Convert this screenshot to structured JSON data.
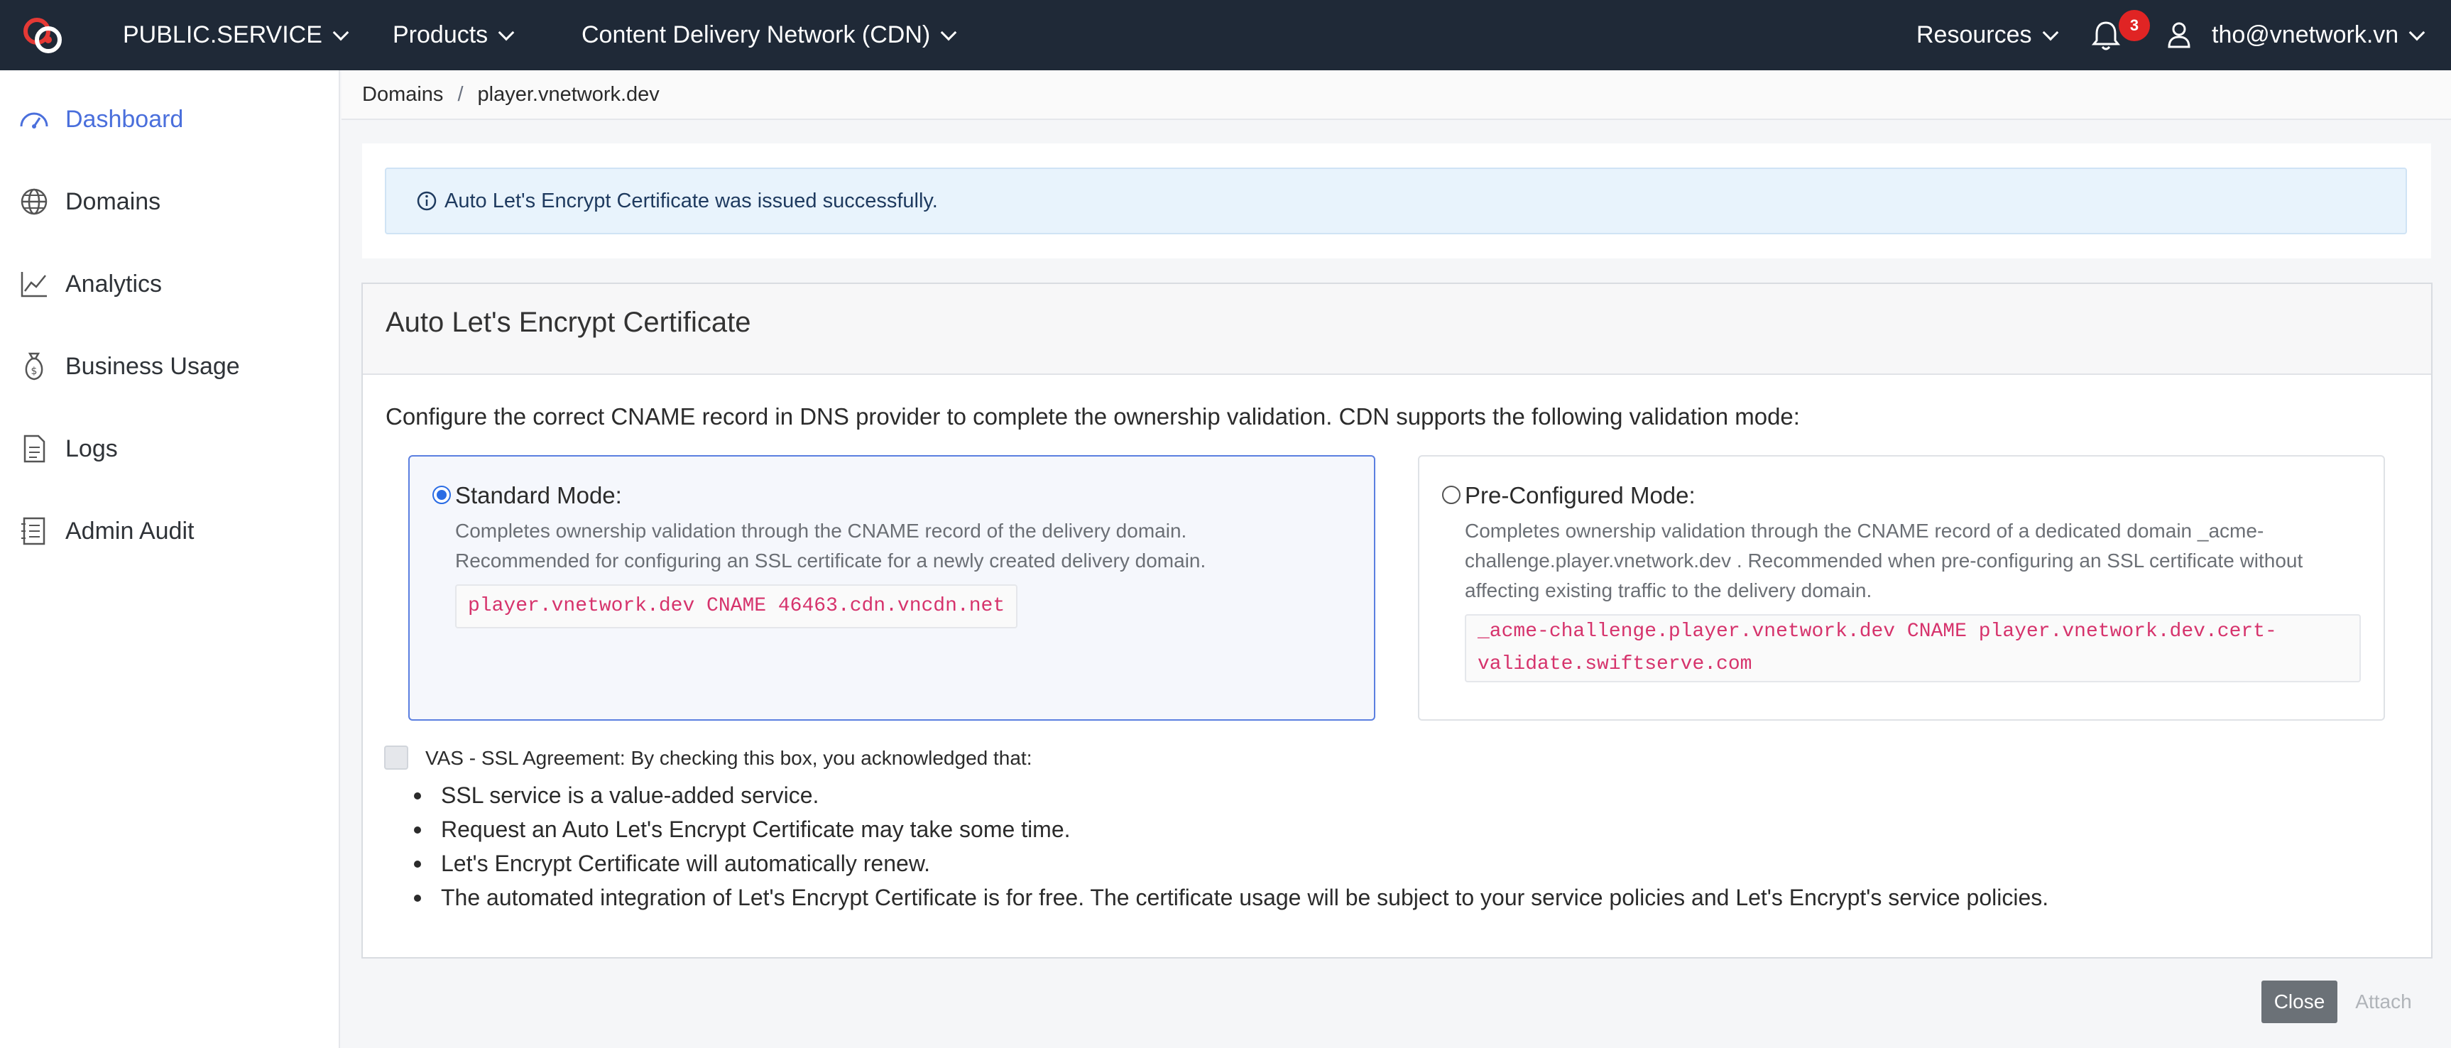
{
  "topbar": {
    "account": "PUBLIC.SERVICE",
    "products": "Products",
    "cdn": "Content Delivery Network (CDN)",
    "resources": "Resources",
    "notification_count": "3",
    "user_email": "tho@vnetwork.vn"
  },
  "sidebar": {
    "items": [
      {
        "label": "Dashboard",
        "icon": "dashboard-icon",
        "active": true
      },
      {
        "label": "Domains",
        "icon": "globe-icon"
      },
      {
        "label": "Analytics",
        "icon": "chart-line-icon"
      },
      {
        "label": "Business Usage",
        "icon": "money-bag-icon"
      },
      {
        "label": "Logs",
        "icon": "file-icon"
      },
      {
        "label": "Admin Audit",
        "icon": "audit-list-icon"
      }
    ]
  },
  "breadcrumb": {
    "root": "Domains",
    "separator": "/",
    "current": "player.vnetwork.dev"
  },
  "alert": {
    "message": "Auto Let's Encrypt Certificate was issued successfully."
  },
  "panel": {
    "title": "Auto Let's Encrypt Certificate",
    "description": "Configure the correct CNAME record in DNS provider to complete the ownership validation. CDN supports the following validation mode:",
    "standard": {
      "title": "Standard Mode:",
      "line1": "Completes ownership validation through the CNAME record of the delivery domain.",
      "line2": "Recommended for configuring an SSL certificate for a newly created delivery domain.",
      "record": "player.vnetwork.dev CNAME 46463.cdn.vncdn.net",
      "selected": true
    },
    "preconfigured": {
      "title": "Pre-Configured Mode:",
      "line1": "Completes ownership validation through the CNAME record of a dedicated domain _acme-",
      "line2": "challenge.player.vnetwork.dev . Recommended when pre-configuring an SSL certificate without",
      "line3": "affecting existing traffic to the delivery domain.",
      "record_line1": "_acme-challenge.player.vnetwork.dev CNAME player.vnetwork.dev.cert-",
      "record_line2": "validate.swiftserve.com",
      "selected": false
    },
    "agreement": {
      "title": "VAS - SSL Agreement: By checking this box, you acknowledged that:",
      "checked": false,
      "bullets": [
        "SSL service is a value-added service.",
        "Request an Auto Let's Encrypt Certificate may take some time.",
        "Let's Encrypt Certificate will automatically renew.",
        "The automated integration of Let's Encrypt Certificate is for free. The certificate usage will be subject to your service policies and Let's Encrypt's service policies."
      ]
    }
  },
  "footer": {
    "close_label": "Close",
    "attach_label": "Attach"
  },
  "colors": {
    "topbar": "#1f2937",
    "accent": "#4a6fdc",
    "code": "#d6336c",
    "badge": "#e02424"
  }
}
